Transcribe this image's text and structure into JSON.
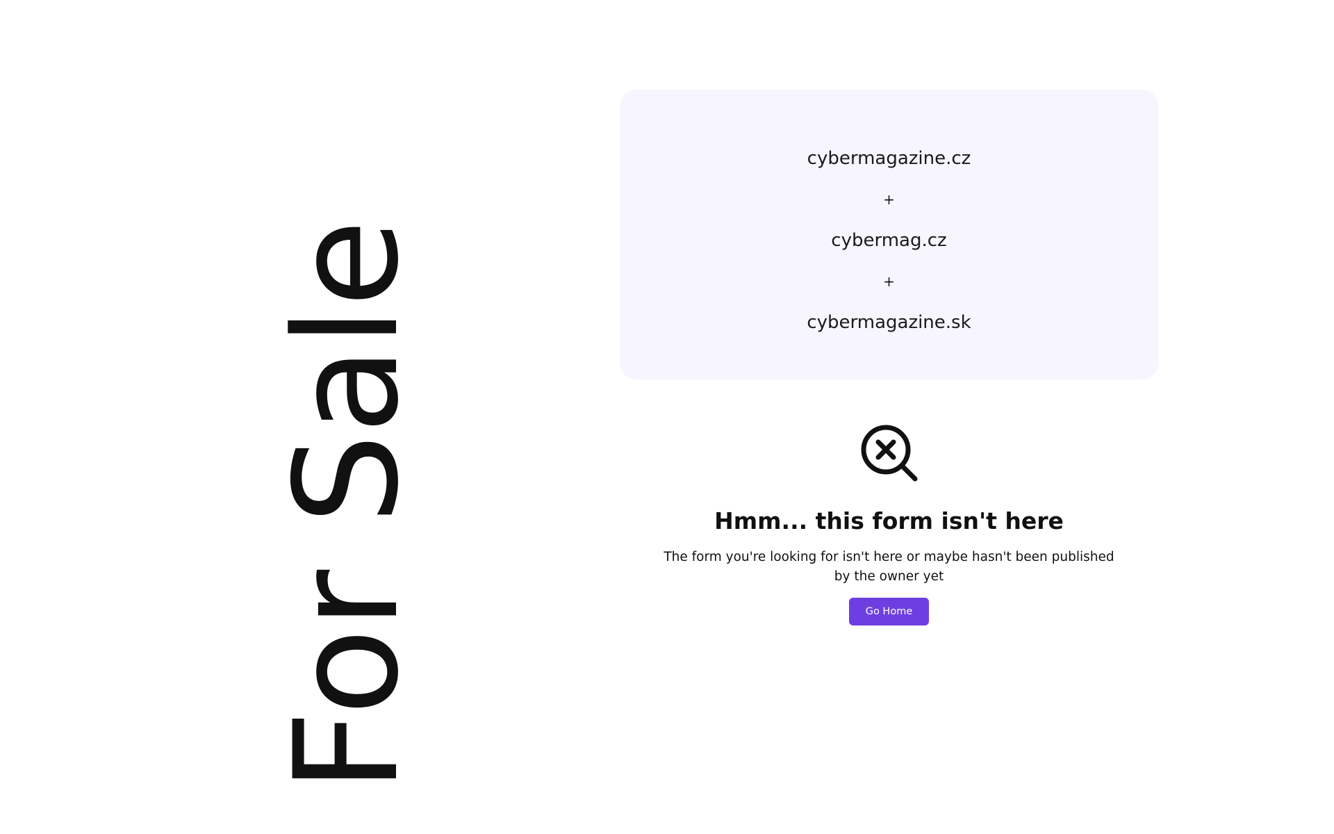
{
  "banner": {
    "text": "For Sale"
  },
  "domains": {
    "items": [
      "cybermagazine.cz",
      "cybermag.cz",
      "cybermagazine.sk"
    ],
    "separator": "+"
  },
  "not_found": {
    "icon": "search-x-icon",
    "title": "Hmm... this form isn't here",
    "description": "The form you're looking for isn't here or maybe hasn't been published by the owner yet",
    "button_label": "Go Home"
  },
  "colors": {
    "accent": "#6e3fe0",
    "card_background": "#f7f5fd",
    "text": "#111111"
  }
}
